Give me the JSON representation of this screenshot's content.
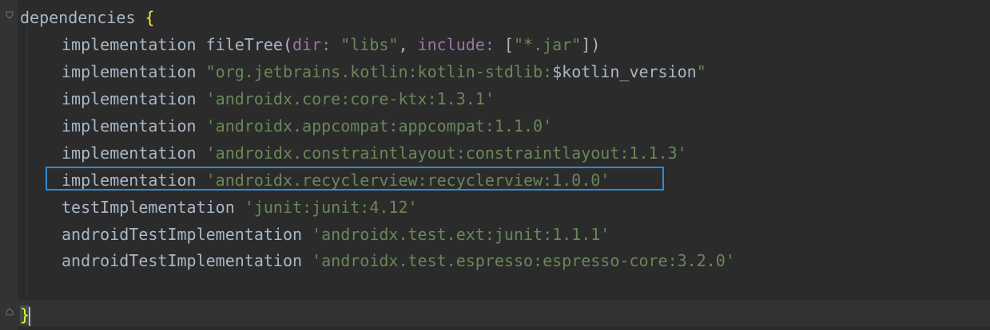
{
  "editor": {
    "lines": [
      {
        "kw": "dependencies",
        "brace": "{"
      },
      {
        "kw": "implementation",
        "call": "fileTree(",
        "p1": "dir:",
        "s1": "\"libs\"",
        "sep": ", ",
        "p2": "include:",
        "bracket_open": " [",
        "s2": "\"*.jar\"",
        "bracket_close": "])"
      },
      {
        "kw": "implementation",
        "s_open": "\"org.jetbrains.kotlin:kotlin-stdlib:",
        "var": "$kotlin_version",
        "s_close": "\""
      },
      {
        "kw": "implementation",
        "str": "'androidx.core:core-ktx:1.3.1'"
      },
      {
        "kw": "implementation",
        "str": "'androidx.appcompat:appcompat:1.1.0'"
      },
      {
        "kw": "implementation",
        "str": "'androidx.constraintlayout:constraintlayout:1.1.3'"
      },
      {
        "kw": "implementation",
        "str": "'androidx.recyclerview:recyclerview:1.0.0'"
      },
      {
        "kw": "testImplementation",
        "str": "'junit:junit:4.12'"
      },
      {
        "kw": "androidTestImplementation",
        "str": "'androidx.test.ext:junit:1.1.1'"
      },
      {
        "kw": "androidTestImplementation",
        "str": "'androidx.test.espresso:espresso-core:3.2.0'"
      },
      {
        "brace": "}"
      }
    ]
  },
  "colors": {
    "background": "#2b2b2b",
    "string": "#6a8759",
    "identifier": "#a9b7c6",
    "param": "#9876aa",
    "brace_match": "#ffef28",
    "highlight_border": "#2c8dd6"
  }
}
